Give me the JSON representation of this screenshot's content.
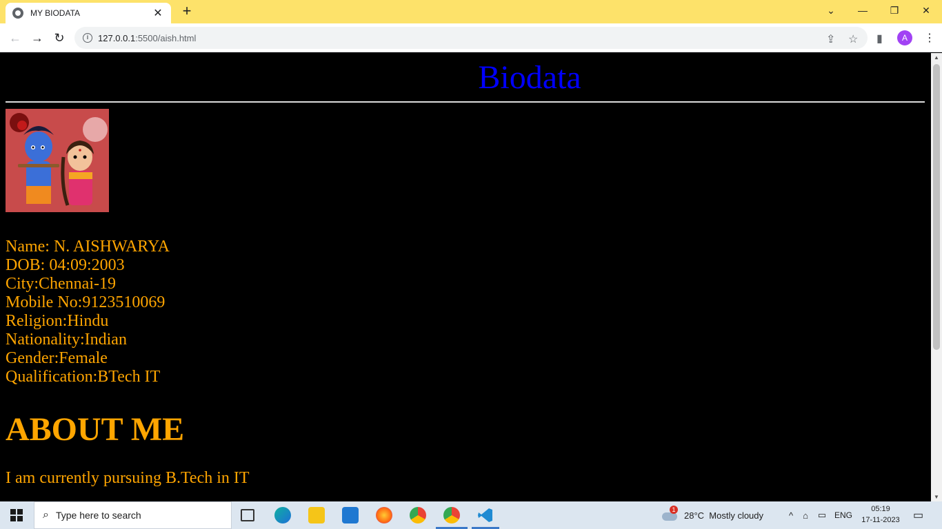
{
  "browser": {
    "tab_title": "MY BIODATA",
    "url_host": "127.0.0.1",
    "url_rest": ":5500/aish.html",
    "profile_initial": "A"
  },
  "page": {
    "heading": "Biodata",
    "details": [
      "Name: N. AISHWARYA",
      "DOB: 04:09:2003",
      "City:Chennai-19",
      "Mobile No:9123510069",
      "Religion:Hindu",
      "Nationality:Indian",
      "Gender:Female",
      "Qualification:BTech IT"
    ],
    "about_heading": "ABOUT ME",
    "about_text": "I am currently pursuing B.Tech in IT"
  },
  "taskbar": {
    "search_placeholder": "Type here to search",
    "weather": "28°C  Mostly cloudy",
    "weather_badge": "1",
    "language": "ENG",
    "time": "05:19",
    "date": "17-11-2023"
  },
  "colors": {
    "heading": "#0000ff",
    "text": "#ffa500",
    "background": "#000000",
    "tabstrip": "#fde26a"
  }
}
